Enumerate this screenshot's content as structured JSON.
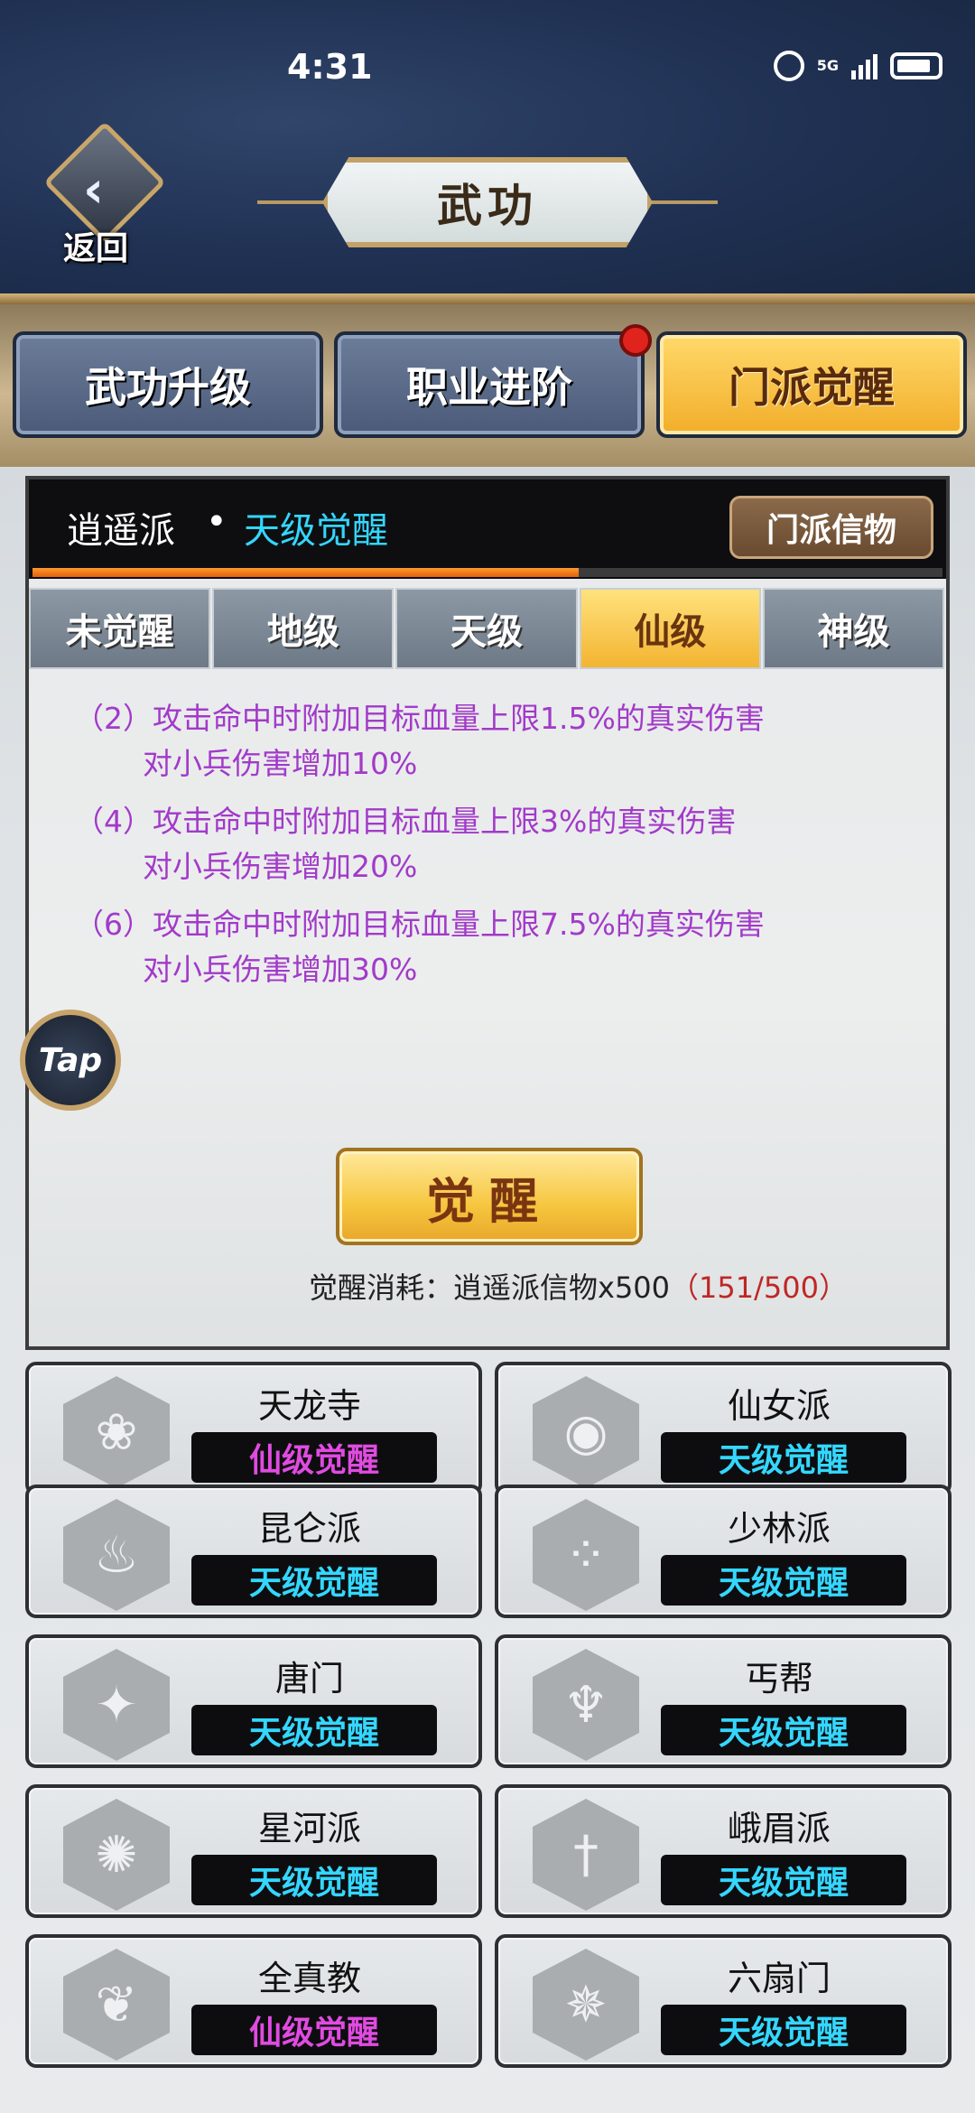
{
  "status_bar": {
    "time": "4:31",
    "network": "5G"
  },
  "header": {
    "back_label": "返回",
    "title": "武功"
  },
  "main_tabs": [
    {
      "label": "武功升级",
      "active": false,
      "badge": false
    },
    {
      "label": "职业进阶",
      "active": false,
      "badge": true
    },
    {
      "label": "门派觉醒",
      "active": true,
      "badge": false
    }
  ],
  "panel": {
    "sect": "逍遥派",
    "separator": "•",
    "awaken_level": "天级觉醒",
    "relic_button": "门派信物",
    "progress_fraction": 0.6,
    "level_tabs": [
      {
        "label": "未觉醒",
        "active": false
      },
      {
        "label": "地级",
        "active": false
      },
      {
        "label": "天级",
        "active": false
      },
      {
        "label": "仙级",
        "active": true
      },
      {
        "label": "神级",
        "active": false
      }
    ],
    "effects": [
      {
        "main": "（2）攻击命中时附加目标血量上限1.5%的真实伤害",
        "sub": "对小兵伤害增加10%"
      },
      {
        "main": "（4）攻击命中时附加目标血量上限3%的真实伤害",
        "sub": "对小兵伤害增加20%"
      },
      {
        "main": "（6）攻击命中时附加目标血量上限7.5%的真实伤害",
        "sub": "对小兵伤害增加30%"
      }
    ],
    "awaken_button": "觉醒",
    "cost_label": "觉醒消耗：逍遥派信物x500",
    "cost_count": "（151/500）"
  },
  "tap_label": "Tap",
  "sects": [
    {
      "name": "天龙寺",
      "level": "仙级觉醒",
      "tier": "xian",
      "icon": "lotus-flame-icon",
      "glyph": "❀"
    },
    {
      "name": "仙女派",
      "level": "天级觉醒",
      "tier": "tian",
      "icon": "eye-icon",
      "glyph": "◉"
    },
    {
      "name": "昆仑派",
      "level": "天级觉醒",
      "tier": "tian",
      "icon": "flame-icon",
      "glyph": "♨"
    },
    {
      "name": "少林派",
      "level": "天级觉醒",
      "tier": "tian",
      "icon": "prayer-beads-icon",
      "glyph": "⁘"
    },
    {
      "name": "唐门",
      "level": "天级觉醒",
      "tier": "tian",
      "icon": "shuriken-icon",
      "glyph": "✦"
    },
    {
      "name": "丐帮",
      "level": "天级觉醒",
      "tier": "tian",
      "icon": "dragon-icon",
      "glyph": "♆"
    },
    {
      "name": "星河派",
      "level": "天级觉醒",
      "tier": "tian",
      "icon": "sun-icon",
      "glyph": "✺"
    },
    {
      "name": "峨眉派",
      "level": "天级觉醒",
      "tier": "tian",
      "icon": "sword-icon",
      "glyph": "†"
    },
    {
      "name": "全真教",
      "level": "仙级觉醒",
      "tier": "xian",
      "icon": "wing-icon",
      "glyph": "❦"
    },
    {
      "name": "六扇门",
      "level": "天级觉醒",
      "tier": "tian",
      "icon": "eye-star-icon",
      "glyph": "✵"
    }
  ]
}
